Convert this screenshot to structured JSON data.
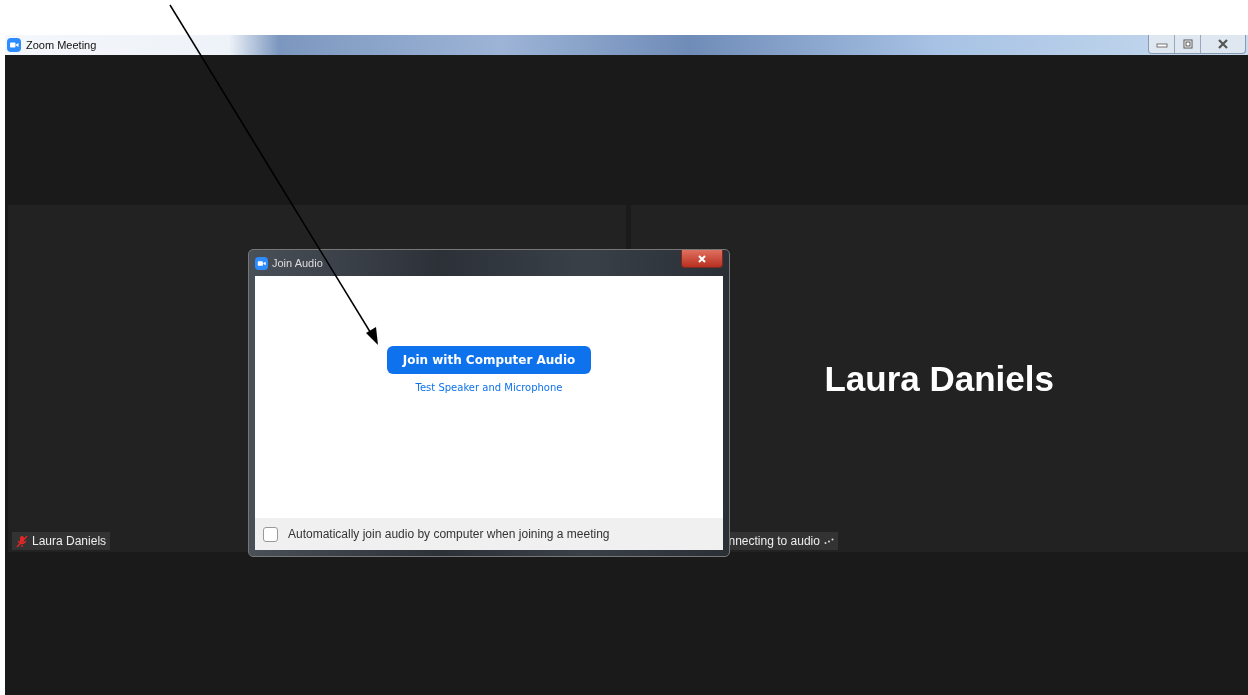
{
  "window": {
    "title": "Zoom Meeting"
  },
  "tiles": [
    {
      "name_label": "Laura Daniels",
      "muted": true
    },
    {
      "display_name": "Laura Daniels",
      "status": "nnecting to audio"
    }
  ],
  "dialog": {
    "title": "Join Audio",
    "primary_button": "Join with Computer Audio",
    "link": "Test Speaker and Microphone",
    "auto_join": {
      "label": "Automatically join audio by computer when joining a meeting",
      "checked": false
    }
  }
}
